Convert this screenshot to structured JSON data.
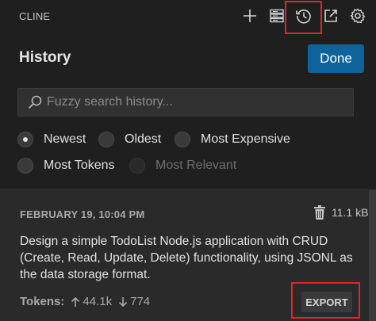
{
  "header": {
    "app_title": "CLINE",
    "icons": [
      "plus-icon",
      "server-icon",
      "history-icon",
      "popout-icon",
      "gear-icon"
    ],
    "highlight_color": "#e0262b"
  },
  "history": {
    "title": "History",
    "done_label": "Done",
    "search": {
      "placeholder": "Fuzzy search history...",
      "value": ""
    },
    "sort_options": [
      {
        "label": "Newest",
        "checked": true,
        "disabled": false
      },
      {
        "label": "Oldest",
        "checked": false,
        "disabled": false
      },
      {
        "label": "Most Expensive",
        "checked": false,
        "disabled": false
      },
      {
        "label": "Most Tokens",
        "checked": false,
        "disabled": false
      },
      {
        "label": "Most Relevant",
        "checked": false,
        "disabled": true
      }
    ],
    "items": [
      {
        "date": "FEBRUARY 19, 10:04 PM",
        "size": "11.1 kB",
        "task": "Design a simple TodoList Node.js application with CRUD (Create, Read, Update, Delete) functionality, using JSONL as the data storage format.",
        "tokens_label": "Tokens:",
        "tokens_in": "44.1k",
        "tokens_out": "774",
        "export_label": "EXPORT"
      }
    ]
  },
  "colors": {
    "background": "#1f1f1f",
    "accent_button": "#0e639c",
    "item_background": "#2a2a2a"
  }
}
